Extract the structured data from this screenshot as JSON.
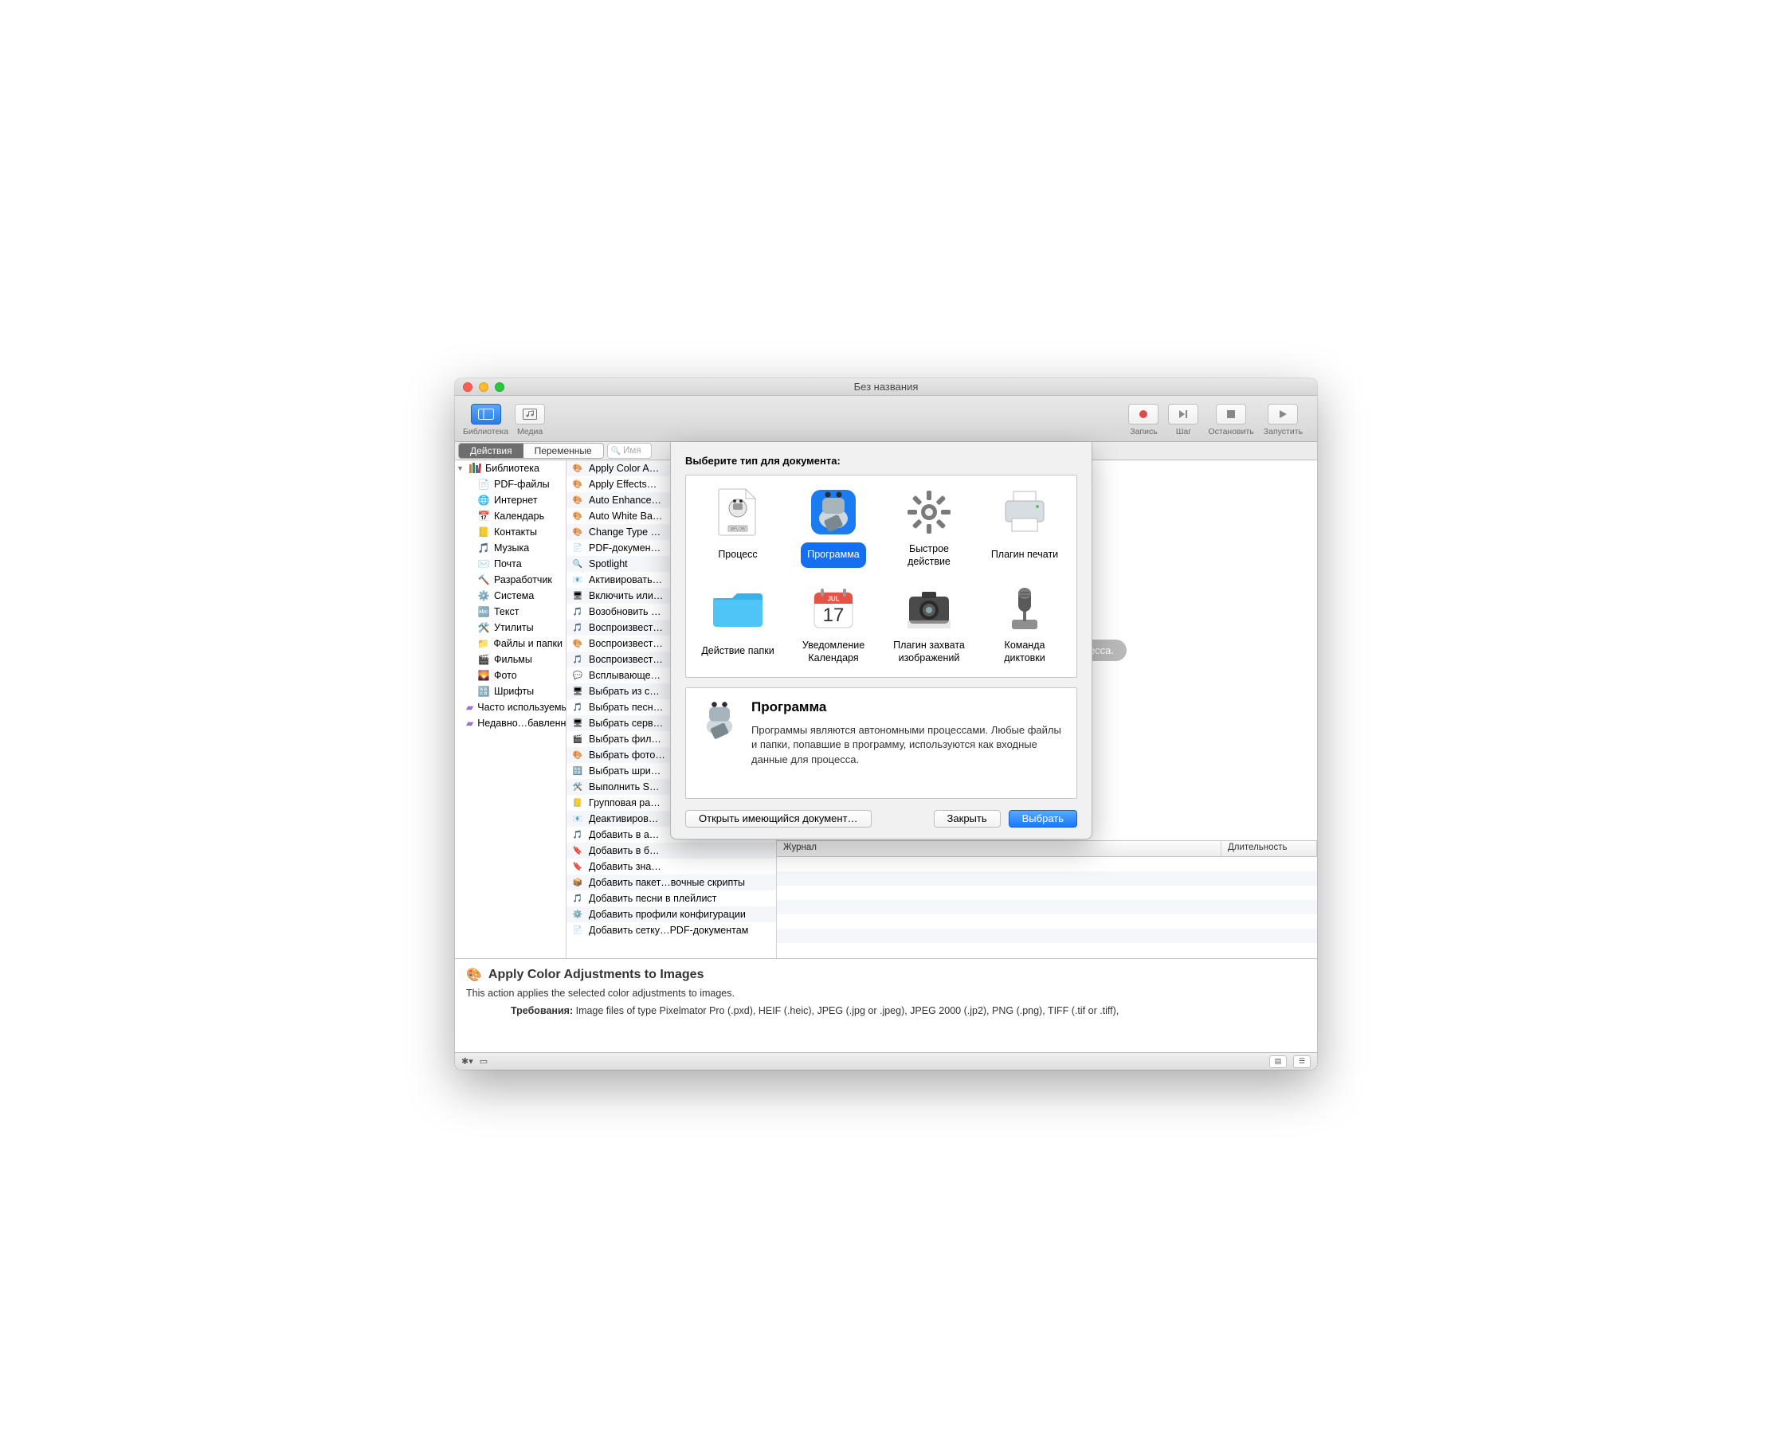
{
  "window": {
    "title": "Без названия"
  },
  "toolbar": {
    "library": "Библиотека",
    "media": "Медиа",
    "record": "Запись",
    "step": "Шаг",
    "stop": "Остановить",
    "run": "Запустить"
  },
  "tabs": {
    "actions": "Действия",
    "variables": "Переменные"
  },
  "search": {
    "placeholder": "Имя"
  },
  "sidebar": {
    "root": "Библиотека",
    "items": [
      {
        "label": "PDF-файлы"
      },
      {
        "label": "Интернет"
      },
      {
        "label": "Календарь"
      },
      {
        "label": "Контакты"
      },
      {
        "label": "Музыка"
      },
      {
        "label": "Почта"
      },
      {
        "label": "Разработчик"
      },
      {
        "label": "Система"
      },
      {
        "label": "Текст"
      },
      {
        "label": "Утилиты"
      },
      {
        "label": "Файлы и папки"
      },
      {
        "label": "Фильмы"
      },
      {
        "label": "Фото"
      },
      {
        "label": "Шрифты"
      }
    ],
    "smart": [
      {
        "label": "Часто используемые"
      },
      {
        "label": "Недавно…бавленные"
      }
    ]
  },
  "actions": [
    "Apply Color A…",
    "Apply Effects…",
    "Auto Enhance…",
    "Auto White Ba…",
    "Change Type …",
    "PDF-докумен…",
    "Spotlight",
    "Активировать…",
    "Включить или…",
    "Возобновить …",
    "Воспроизвест…",
    "Воспроизвест…",
    "Воспроизвест…",
    "Всплывающе…",
    "Выбрать из с…",
    "Выбрать песн…",
    "Выбрать серв…",
    "Выбрать фил…",
    "Выбрать фото…",
    "Выбрать шри…",
    "Выполнить S…",
    "Групповая ра…",
    "Деактивиров…",
    "Добавить в а…",
    "Добавить в б…",
    "Добавить зна…",
    "Добавить пакет…вочные скрипты",
    "Добавить песни в плейлист",
    "Добавить профили конфигурации",
    "Добавить сетку…PDF-документам"
  ],
  "workflow": {
    "hint": "создания Вашего процесса."
  },
  "log": {
    "col1": "Журнал",
    "col2": "Длительность"
  },
  "desc": {
    "title": "Apply Color Adjustments to Images",
    "body": "This action applies the selected color adjustments to images.",
    "req_label": "Требования:",
    "req_body": "Image files of type Pixelmator Pro (.pxd), HEIF (.heic), JPEG (.jpg or .jpeg), JPEG 2000 (.jp2), PNG (.png), TIFF (.tif or .tiff),"
  },
  "sheet": {
    "title": "Выберите тип для документа:",
    "types": [
      {
        "label": "Процесс"
      },
      {
        "label": "Программа",
        "selected": true
      },
      {
        "label": "Быстрое действие"
      },
      {
        "label": "Плагин печати"
      },
      {
        "label": "Действие папки"
      },
      {
        "label": "Уведомление Календаря"
      },
      {
        "label": "Плагин захвата изображений"
      },
      {
        "label": "Команда диктовки"
      }
    ],
    "desc_title": "Программа",
    "desc_body": "Программы являются автономными процессами. Любые файлы и папки, попавшие в программу, используются как входные данные для процесса.",
    "open": "Открыть имеющийся документ…",
    "close": "Закрыть",
    "choose": "Выбрать"
  }
}
